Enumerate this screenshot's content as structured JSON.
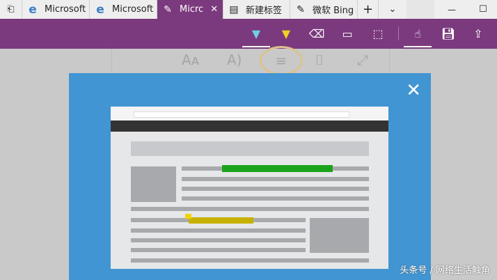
{
  "tabs": [
    {
      "label": "",
      "icon": "tab-aside-icon"
    },
    {
      "label": "Microsoft",
      "icon": "edge-icon"
    },
    {
      "label": "Microsoft",
      "icon": "edge-icon"
    },
    {
      "label": "Micrc",
      "icon": "web-note-icon",
      "active": true
    },
    {
      "label": "新建标签",
      "icon": "new-tab-icon"
    },
    {
      "label": "微软 Bing",
      "icon": "web-note-icon"
    }
  ],
  "window": {
    "new_tab": "+",
    "tab_list": "⌄",
    "minimize": "—",
    "maximize": "☐"
  },
  "watermark": "头条号 / 网络生活触角",
  "colors": {
    "accent": "#7b3a7e",
    "overlay": "#4195d3",
    "green_highlight": "#1aa31a",
    "yellow_highlight": "#c7b100"
  }
}
